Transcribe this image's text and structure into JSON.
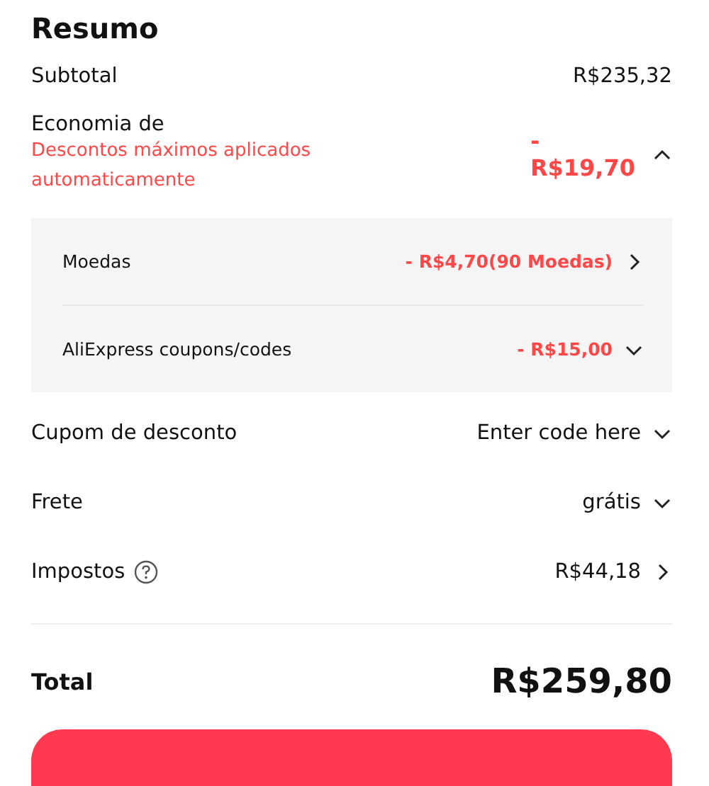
{
  "title": "Resumo",
  "subtotal": {
    "label": "Subtotal",
    "value": "R$235,32"
  },
  "savings": {
    "label": "Economia de",
    "note": "Descontos máximos aplicados automaticamente",
    "sign": "-",
    "value": "R$19,70",
    "expanded": true,
    "items": [
      {
        "label": "Moedas",
        "value": "- R$4,70(90 Moedas)",
        "kind": "link"
      },
      {
        "label": "AliExpress coupons/codes",
        "value": "- R$15,00",
        "kind": "dropdown"
      }
    ]
  },
  "rows": [
    {
      "label": "Cupom de desconto",
      "value": "Enter code here",
      "kind": "dropdown",
      "help": false
    },
    {
      "label": "Frete",
      "value": "grátis",
      "kind": "dropdown",
      "help": false
    },
    {
      "label": "Impostos",
      "value": "R$44,18",
      "kind": "link",
      "help": true
    }
  ],
  "total": {
    "label": "Total",
    "value": "R$259,80"
  }
}
